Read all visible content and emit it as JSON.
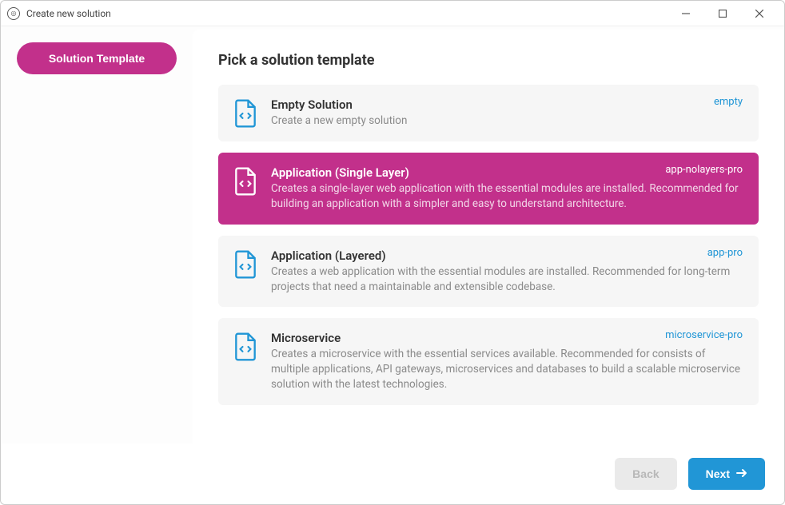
{
  "window": {
    "title": "Create new solution"
  },
  "sidebar": {
    "button_label": "Solution Template"
  },
  "main": {
    "heading": "Pick a solution template"
  },
  "templates": [
    {
      "title": "Empty Solution",
      "description": "Create a new empty solution",
      "tag": "empty",
      "selected": false
    },
    {
      "title": "Application (Single Layer)",
      "description": "Creates a single-layer web application with the essential modules are installed. Recommended for building an application with a simpler and easy to understand architecture.",
      "tag": "app-nolayers-pro",
      "selected": true
    },
    {
      "title": "Application (Layered)",
      "description": "Creates a web application with the essential modules are installed. Recommended for long-term projects that need a maintainable and extensible codebase.",
      "tag": "app-pro",
      "selected": false
    },
    {
      "title": "Microservice",
      "description": "Creates a microservice with the essential services available. Recommended for consists of multiple applications, API gateways, microservices and databases to build a scalable microservice solution with the latest technologies.",
      "tag": "microservice-pro",
      "selected": false
    }
  ],
  "footer": {
    "back_label": "Back",
    "next_label": "Next"
  },
  "colors": {
    "accent_pink": "#c2308b",
    "accent_blue": "#2196d6"
  }
}
